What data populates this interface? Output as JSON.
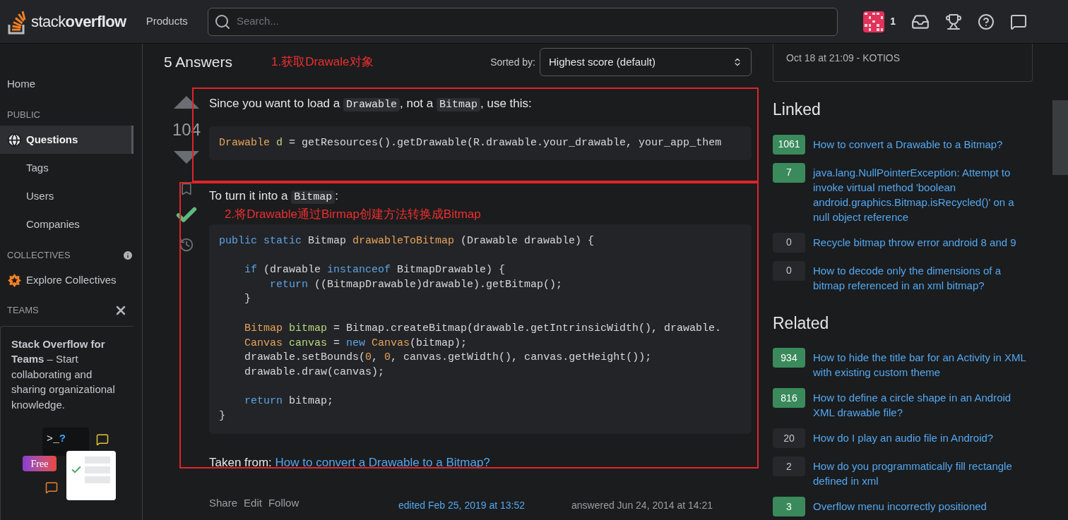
{
  "topbar": {
    "logo": "stack**overflow**",
    "products": "Products",
    "search": {
      "placeholder": "Search..."
    },
    "reputation": "1"
  },
  "sidebar": {
    "home": "Home",
    "sections": [
      {
        "title": "PUBLIC",
        "items": [
          {
            "label": "Questions",
            "selected": true,
            "kind": "globe"
          },
          {
            "label": "Tags",
            "selected": false,
            "kind": "plain"
          },
          {
            "label": "Users",
            "selected": false,
            "kind": "plain"
          },
          {
            "label": "Companies",
            "selected": false,
            "kind": "plain"
          }
        ]
      },
      {
        "title": "COLLECTIVES",
        "items": [
          {
            "label": "Explore Collectives",
            "selected": false,
            "kind": "star"
          }
        ]
      }
    ],
    "teams": {
      "title": "TEAMS",
      "promo": "**Stack Overflow for Teams** – Start collaborating and sharing organizational knowledge.",
      "prompt": ">_?",
      "badge": "Free"
    }
  },
  "answers": {
    "heading": "5 Answers",
    "sort_label": "Sorted by:",
    "sort_value": "Highest score (default)",
    "annotation_1": "1.获取Drawale对象",
    "annotation_2": "2.将Drawable通过Birmap创建方法转换成Bitmap",
    "answer": {
      "score": "104",
      "accepted": true,
      "intro": [
        {
          "t": "Since you want to load a "
        },
        {
          "code": "Drawable"
        },
        {
          "t": ", not a "
        },
        {
          "code": "Bitmap"
        },
        {
          "t": ", use this:"
        }
      ],
      "code_1": [
        {
          "blank_before": false,
          "tokens": [
            {
              "t": "Drawable",
              "color": "#e8a35a"
            },
            {
              "t": " d",
              "color": "#b9d77e"
            },
            {
              "t": " = getResources().getDrawable(R.drawable.your_drawable, your_app_them",
              "color": "#d6d8da"
            }
          ]
        }
      ],
      "middle": [
        {
          "t": "To turn it into a "
        },
        {
          "code": "Bitmap"
        },
        {
          "t": ":"
        }
      ],
      "code_2": [
        {
          "blank_before": false,
          "tokens": [
            {
              "t": "public",
              "color": "#5ba4e5"
            },
            {
              "t": " static",
              "color": "#5ba4e5"
            },
            {
              "t": " Bitmap ",
              "color": "#d6d8da"
            },
            {
              "t": "drawableToBitmap",
              "color": "#e8a35a"
            },
            {
              "t": " (Drawable drawable) {",
              "color": "#d6d8da"
            }
          ]
        },
        {
          "blank_before": true,
          "tokens": [
            {
              "t": "    if",
              "color": "#5ba4e5"
            },
            {
              "t": " (drawable ",
              "color": "#d6d8da"
            },
            {
              "t": "instanceof",
              "color": "#5ba4e5"
            },
            {
              "t": " BitmapDrawable) {",
              "color": "#d6d8da"
            }
          ]
        },
        {
          "blank_before": false,
          "tokens": [
            {
              "t": "        return",
              "color": "#5ba4e5"
            },
            {
              "t": " ((BitmapDrawable)drawable).getBitmap();",
              "color": "#d6d8da"
            }
          ]
        },
        {
          "blank_before": false,
          "tokens": [
            {
              "t": "    }",
              "color": "#d6d8da"
            }
          ]
        },
        {
          "blank_before": true,
          "tokens": [
            {
              "t": "    Bitmap",
              "color": "#e8a35a"
            },
            {
              "t": " bitmap",
              "color": "#b9d77e"
            },
            {
              "t": " = Bitmap.createBitmap(drawable.getIntrinsicWidth(), drawable.",
              "color": "#d6d8da"
            }
          ]
        },
        {
          "blank_before": false,
          "tokens": [
            {
              "t": "    Canvas",
              "color": "#e8a35a"
            },
            {
              "t": " canvas",
              "color": "#b9d77e"
            },
            {
              "t": " = ",
              "color": "#d6d8da"
            },
            {
              "t": "new",
              "color": "#5ba4e5"
            },
            {
              "t": " Canvas",
              "color": "#e8a35a"
            },
            {
              "t": "(bitmap);",
              "color": "#d6d8da"
            }
          ]
        },
        {
          "blank_before": false,
          "tokens": [
            {
              "t": "    drawable.setBounds(",
              "color": "#d6d8da"
            },
            {
              "t": "0",
              "color": "#e8a35a"
            },
            {
              "t": ", ",
              "color": "#d6d8da"
            },
            {
              "t": "0",
              "color": "#e8a35a"
            },
            {
              "t": ", canvas.getWidth(), canvas.getHeight());",
              "color": "#d6d8da"
            }
          ]
        },
        {
          "blank_before": false,
          "tokens": [
            {
              "t": "    drawable.draw(canvas);",
              "color": "#d6d8da"
            }
          ]
        },
        {
          "blank_before": true,
          "tokens": [
            {
              "t": "    return",
              "color": "#5ba4e5"
            },
            {
              "t": " bitmap;",
              "color": "#d6d8da"
            }
          ]
        },
        {
          "blank_before": false,
          "tokens": [
            {
              "t": "}",
              "color": "#d6d8da"
            }
          ]
        }
      ],
      "source_label": "Taken from:",
      "source_link": "How to convert a Drawable to a Bitmap?",
      "actions": [
        "Share",
        "Edit",
        "Follow"
      ],
      "edited": "edited Feb 25, 2019 at 13:52",
      "answered": "answered Jun 24, 2014 at 14:21"
    }
  },
  "right": {
    "comment_meta": "Oct 18 at 21:09 - KOTIOS",
    "lists": [
      {
        "title": "Linked",
        "items": [
          {
            "score": "1061",
            "answered": true,
            "title": "How to convert a Drawable to a Bitmap?"
          },
          {
            "score": "7",
            "answered": true,
            "title": "java.lang.NullPointerException: Attempt to invoke virtual method 'boolean android.graphics.Bitmap.isRecycled()' on a null object reference"
          },
          {
            "score": "0",
            "answered": false,
            "title": "Recycle bitmap throw error android 8 and 9"
          },
          {
            "score": "0",
            "answered": false,
            "title": "How to decode only the dimensions of a bitmap referenced in an xml bitmap?"
          }
        ]
      },
      {
        "title": "Related",
        "items": [
          {
            "score": "934",
            "answered": true,
            "title": "How to hide the title bar for an Activity in XML with existing custom theme"
          },
          {
            "score": "816",
            "answered": true,
            "title": "How to define a circle shape in an Android XML drawable file?"
          },
          {
            "score": "20",
            "answered": false,
            "title": "How do I play an audio file in Android?"
          },
          {
            "score": "2",
            "answered": false,
            "title": "How do you programmatically fill rectangle defined in xml"
          },
          {
            "score": "3",
            "answered": true,
            "title": "Overflow menu incorrectly positioned"
          }
        ]
      }
    ]
  }
}
